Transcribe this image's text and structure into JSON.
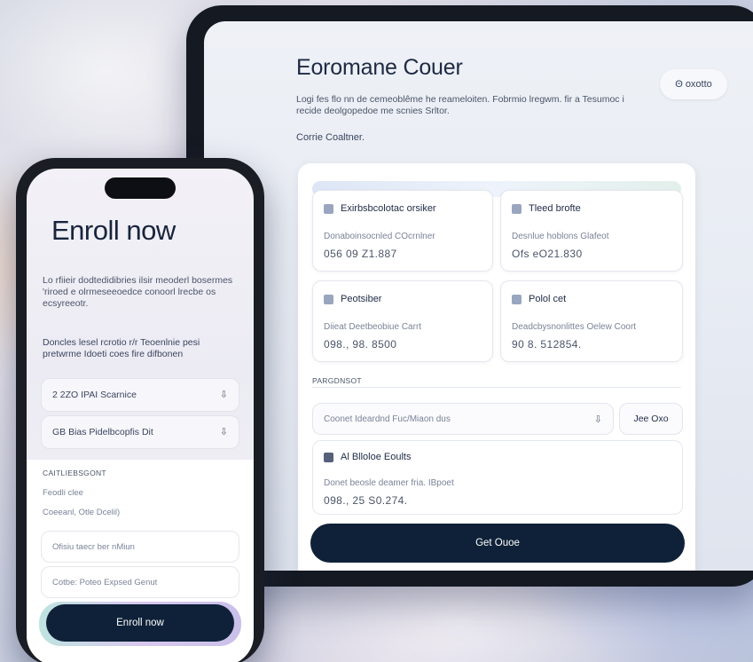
{
  "tablet": {
    "title": "Eoromane Couer",
    "description": "Logi fes flo nn de cemeoblême he reameloiten. Fobrmio lregwm. fir a Tesumoc i recide deolgopedoe me scnies Srltor.",
    "subtitle": "Corrie Coaltner.",
    "top_button": "Θ oxotto",
    "cards": [
      {
        "title": "Exirbsbcolotac orsiker",
        "label": "Donaboinsocnled COcrnlner",
        "value": "056 09 Z1.887"
      },
      {
        "title": "Tleed brofte",
        "label": "Desnlue hoblons Glafeot",
        "value": "Ofs eO21.830"
      },
      {
        "title": "Peotsiber",
        "label": "Diieat Deetbeobiue Carrt",
        "value": "098., 98. 8500"
      },
      {
        "title": "Polol cet",
        "label": "Deadcbysnonlittes Oelew Coort",
        "value": "90 8. 512854."
      }
    ],
    "section_label": "PARGDNSOT",
    "input_value": "Coonet Ideardnd Fuc/Miaon dus",
    "mini_button": "Jee Oxo",
    "summary": {
      "title": "Al Blloloe Eoults",
      "label": "Donet beosle deamer fria. IBpoet",
      "value": "098., 25 S0.274."
    },
    "cta_label": "Get Ouoe"
  },
  "phone": {
    "title": "Enroll now",
    "description": "Lo rfiieir dodtedidibries ilsir meoderl bosermes 'riroed e olrmeseeoedce conoorl lrecbe os ecsyreeotr.",
    "description2": "Doncles lesel rcrotio r/r Teoenlnie pesi pretwrme Idoeti coes fire difbonen",
    "field1": "2 2ZO IPAI Scarnice",
    "field2": "GB Bias Pidelbcopfis Dit",
    "section_label": "CAITLIEBSGONT",
    "small1": "Feodli clee",
    "small2": "Coeeanl, Otle Dcelil)",
    "input1": "Ofisiu taecr ber nMiun",
    "input2": "Cotbe: Poteo Expsed Genut",
    "cta_label": "Enroll now"
  }
}
